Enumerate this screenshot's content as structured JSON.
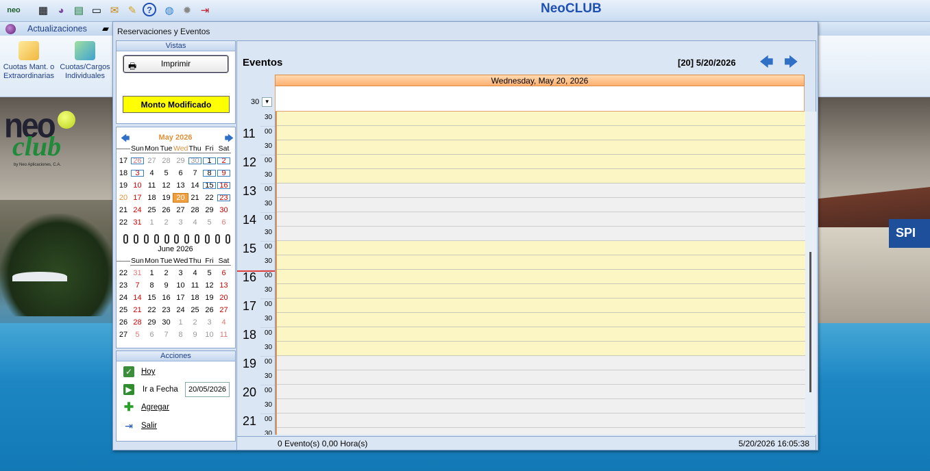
{
  "app": {
    "title": "NeoCLUB"
  },
  "menubar": {
    "item": "Actualizaciones"
  },
  "ribbon": {
    "btn1": {
      "line1": "Cuotas Mant. o",
      "line2": "Extraordinarias"
    },
    "btn2": {
      "line1": "Cuotas/Cargos",
      "line2": "Individuales"
    }
  },
  "logo": {
    "tag": "by Neo Aplicaciones, C.A."
  },
  "dialog": {
    "title": "Reservaciones y Eventos",
    "vistas": {
      "header": "Vistas",
      "print": "Imprimir",
      "monto": "Monto Modificado"
    },
    "calendar": {
      "weekdays": [
        "Sun",
        "Mon",
        "Tue",
        "Wed",
        "Thu",
        "Fri",
        "Sat"
      ],
      "month1": {
        "title": "May 2026",
        "rows": [
          {
            "wk": "17",
            "d": [
              "26",
              "27",
              "28",
              "29",
              "30",
              "1",
              "2"
            ]
          },
          {
            "wk": "18",
            "d": [
              "3",
              "4",
              "5",
              "6",
              "7",
              "8",
              "9"
            ]
          },
          {
            "wk": "19",
            "d": [
              "10",
              "11",
              "12",
              "13",
              "14",
              "15",
              "16"
            ]
          },
          {
            "wk": "20",
            "d": [
              "17",
              "18",
              "19",
              "20",
              "21",
              "22",
              "23"
            ]
          },
          {
            "wk": "21",
            "d": [
              "24",
              "25",
              "26",
              "27",
              "28",
              "29",
              "30"
            ]
          },
          {
            "wk": "22",
            "d": [
              "31",
              "1",
              "2",
              "3",
              "4",
              "5",
              "6"
            ]
          }
        ]
      },
      "month2": {
        "title": "June 2026",
        "rows": [
          {
            "wk": "22",
            "d": [
              "31",
              "1",
              "2",
              "3",
              "4",
              "5",
              "6"
            ]
          },
          {
            "wk": "23",
            "d": [
              "7",
              "8",
              "9",
              "10",
              "11",
              "12",
              "13"
            ]
          },
          {
            "wk": "24",
            "d": [
              "14",
              "15",
              "16",
              "17",
              "18",
              "19",
              "20"
            ]
          },
          {
            "wk": "25",
            "d": [
              "21",
              "22",
              "23",
              "24",
              "25",
              "26",
              "27"
            ]
          },
          {
            "wk": "26",
            "d": [
              "28",
              "29",
              "30",
              "1",
              "2",
              "3",
              "4"
            ]
          },
          {
            "wk": "27",
            "d": [
              "5",
              "6",
              "7",
              "8",
              "9",
              "10",
              "11"
            ]
          }
        ]
      }
    },
    "acciones": {
      "header": "Acciones",
      "hoy": "Hoy",
      "ir": "Ir a Fecha",
      "ir_value": "20/05/2026",
      "agregar": "Agregar",
      "salir": "Salir"
    },
    "events": {
      "title": "Eventos",
      "date_label": "[20]  5/20/2026",
      "day_header": "Wednesday, May 20, 2026",
      "interval": "30",
      "hours": [
        "11",
        "12",
        "13",
        "14",
        "15",
        "16",
        "17",
        "18",
        "19",
        "20",
        "21"
      ],
      "minutes": [
        "00",
        "30"
      ],
      "status_left": "0 Evento(s)   0,00 Hora(s)",
      "status_right": "5/20/2026  16:05:38"
    }
  }
}
